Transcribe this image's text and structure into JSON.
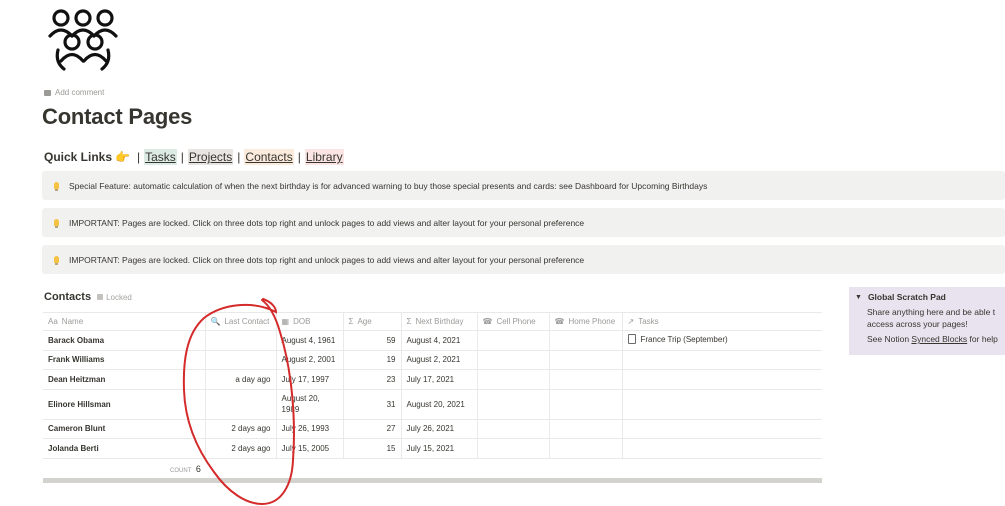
{
  "page": {
    "icon": "people-group-icon",
    "add_comment": "Add comment",
    "title": "Contact Pages"
  },
  "quick_links": {
    "label": "Quick Links",
    "emoji": "👉",
    "separator": "|",
    "links": [
      "Tasks",
      "Projects",
      "Contacts",
      "Library"
    ]
  },
  "callouts": [
    "Special Feature: automatic calculation of when the next birthday is for advanced warning to buy those special presents and cards: see Dashboard for Upcoming Birthdays",
    "IMPORTANT: Pages are locked. Click on three dots top right and unlock pages to add views and alter layout for your personal preference",
    "IMPORTANT: Pages are locked. Click on three dots top right and unlock pages to add views and alter layout for your personal preference"
  ],
  "database": {
    "title": "Contacts",
    "locked_label": "Locked",
    "columns": [
      {
        "icon": "Aa",
        "label": "Name"
      },
      {
        "icon": "🔍",
        "label": "Last Contact"
      },
      {
        "icon": "▦",
        "label": "DOB"
      },
      {
        "icon": "Σ",
        "label": "Age"
      },
      {
        "icon": "Σ",
        "label": "Next Birthday"
      },
      {
        "icon": "☎",
        "label": "Cell Phone"
      },
      {
        "icon": "☎",
        "label": "Home Phone"
      },
      {
        "icon": "↗",
        "label": "Tasks"
      }
    ],
    "rows": [
      {
        "name": "Barack Obama",
        "last_contact": "",
        "dob": "August 4, 1961",
        "age": "59",
        "next_birthday": "August 4, 2021",
        "cell": "",
        "home": "",
        "tasks": "France Trip (September)"
      },
      {
        "name": "Frank Williams",
        "last_contact": "",
        "dob": "August 2, 2001",
        "age": "19",
        "next_birthday": "August 2, 2021",
        "cell": "",
        "home": "",
        "tasks": ""
      },
      {
        "name": "Dean Heitzman",
        "last_contact": "a day ago",
        "dob": "July 17, 1997",
        "age": "23",
        "next_birthday": "July 17, 2021",
        "cell": "",
        "home": "",
        "tasks": ""
      },
      {
        "name": "Elinore Hillsman",
        "last_contact": "",
        "dob": "August 20, 1989",
        "age": "31",
        "next_birthday": "August 20, 2021",
        "cell": "",
        "home": "",
        "tasks": ""
      },
      {
        "name": "Cameron Blunt",
        "last_contact": "2 days ago",
        "dob": "July 26, 1993",
        "age": "27",
        "next_birthday": "July 26, 2021",
        "cell": "",
        "home": "",
        "tasks": ""
      },
      {
        "name": "Jolanda Berti",
        "last_contact": "2 days ago",
        "dob": "July 15, 2005",
        "age": "15",
        "next_birthday": "July 15, 2021",
        "cell": "",
        "home": "",
        "tasks": ""
      }
    ],
    "count_label": "COUNT",
    "count_value": "6"
  },
  "scratch_pad": {
    "toggle": "▼",
    "title": "Global Scratch Pad",
    "line1": "Share anything here and be able t",
    "line2": "access across your pages!",
    "line3_prefix": "See Notion ",
    "line3_link": "Synced Blocks",
    "line3_suffix": " for help"
  },
  "colors": {
    "callout_bg": "#f1f1ef",
    "scratch_bg": "#e8e3ef",
    "annotation_red": "#d42a2a"
  }
}
